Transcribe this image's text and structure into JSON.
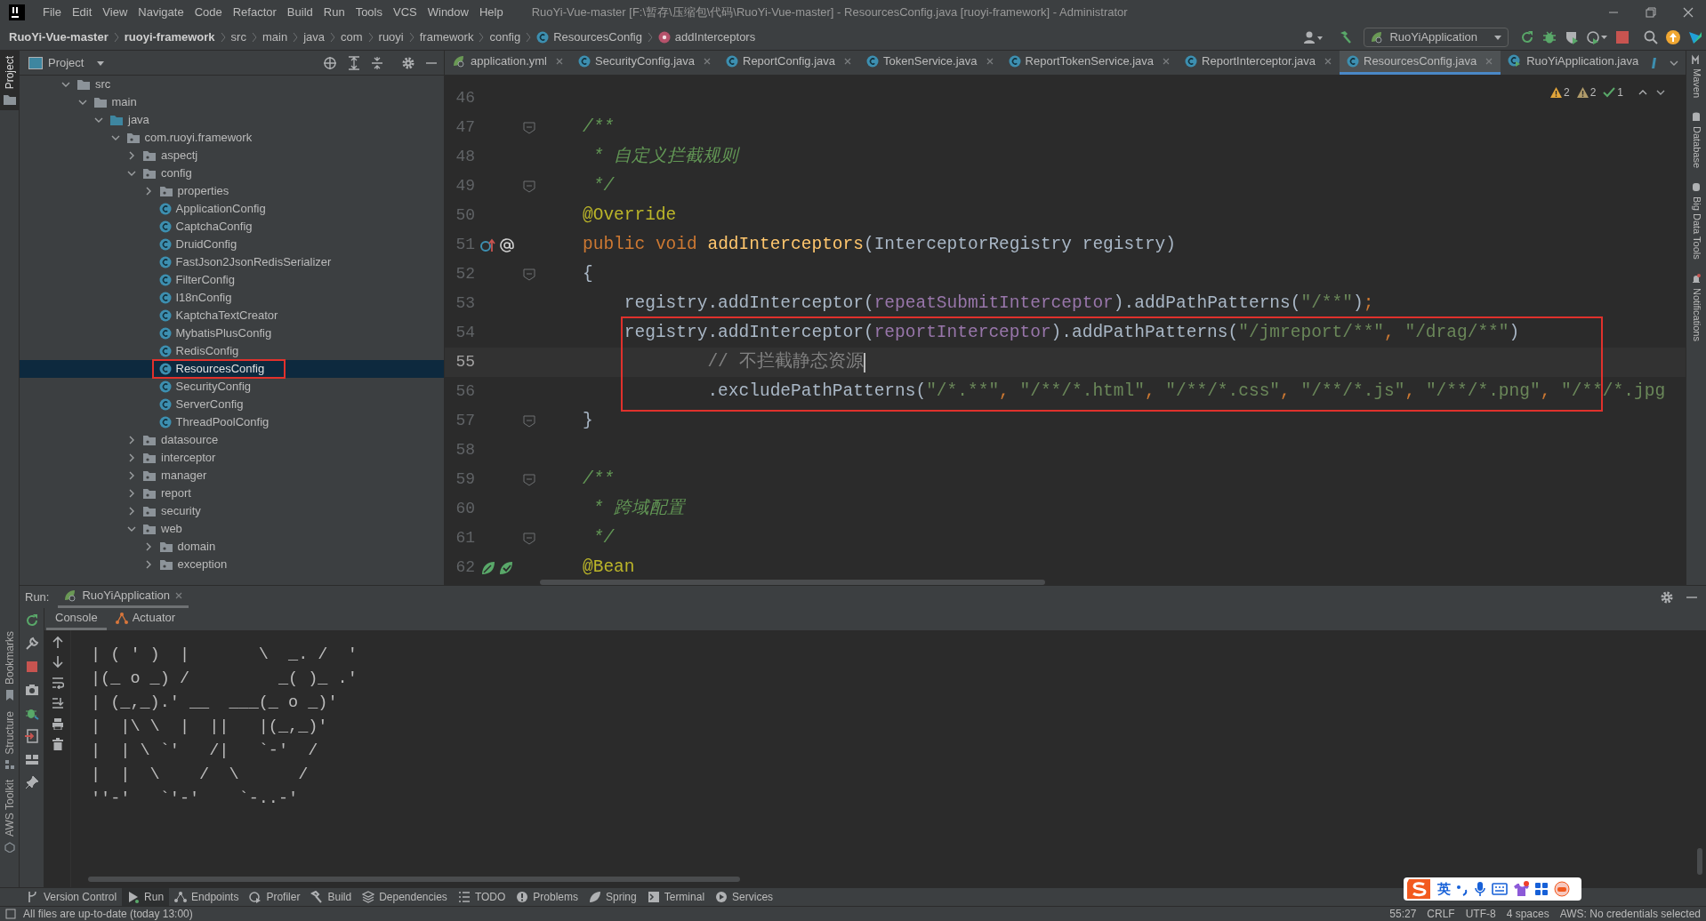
{
  "title_bar": {
    "menu": [
      "File",
      "Edit",
      "View",
      "Navigate",
      "Code",
      "Refactor",
      "Build",
      "Run",
      "Tools",
      "VCS",
      "Window",
      "Help"
    ],
    "title": "RuoYi-Vue-master [F:\\暂存\\压缩包\\代码\\RuoYi-Vue-master] - ResourcesConfig.java [ruoyi-framework] - Administrator"
  },
  "breadcrumbs": [
    {
      "label": "RuoYi-Vue-master",
      "kind": "module"
    },
    {
      "label": "ruoyi-framework",
      "kind": "module"
    },
    {
      "label": "src",
      "kind": "dir"
    },
    {
      "label": "main",
      "kind": "dir"
    },
    {
      "label": "java",
      "kind": "dir"
    },
    {
      "label": "com",
      "kind": "dir"
    },
    {
      "label": "ruoyi",
      "kind": "dir"
    },
    {
      "label": "framework",
      "kind": "dir"
    },
    {
      "label": "config",
      "kind": "dir"
    },
    {
      "label": "ResourcesConfig",
      "kind": "class"
    },
    {
      "label": "addInterceptors",
      "kind": "method"
    }
  ],
  "run_configuration": {
    "label": "RuoYiApplication"
  },
  "left_stripe": [
    {
      "label": "Project",
      "selected": true
    },
    {
      "label": "Bookmarks",
      "selected": false
    },
    {
      "label": "Structure",
      "selected": false
    },
    {
      "label": "AWS Toolkit",
      "selected": false
    }
  ],
  "project_panel": {
    "title": "Project",
    "tree": [
      {
        "label": "src",
        "kind": "folder",
        "expanded": true,
        "selected": false,
        "children": [
          {
            "label": "main",
            "kind": "folder",
            "expanded": true,
            "selected": false,
            "children": [
              {
                "label": "java",
                "kind": "source",
                "expanded": true,
                "selected": false,
                "children": [
                  {
                    "label": "com.ruoyi.framework",
                    "kind": "package",
                    "expanded": true,
                    "selected": false,
                    "children": [
                      {
                        "label": "aspectj",
                        "kind": "package",
                        "expanded": false,
                        "selected": false
                      },
                      {
                        "label": "config",
                        "kind": "package",
                        "expanded": true,
                        "selected": false,
                        "children": [
                          {
                            "label": "properties",
                            "kind": "package",
                            "expanded": false,
                            "selected": false
                          },
                          {
                            "label": "ApplicationConfig",
                            "kind": "class",
                            "selected": false
                          },
                          {
                            "label": "CaptchaConfig",
                            "kind": "class",
                            "selected": false
                          },
                          {
                            "label": "DruidConfig",
                            "kind": "class",
                            "selected": false
                          },
                          {
                            "label": "FastJson2JsonRedisSerializer",
                            "kind": "class",
                            "selected": false
                          },
                          {
                            "label": "FilterConfig",
                            "kind": "class",
                            "selected": false
                          },
                          {
                            "label": "I18nConfig",
                            "kind": "class",
                            "selected": false
                          },
                          {
                            "label": "KaptchaTextCreator",
                            "kind": "class",
                            "selected": false
                          },
                          {
                            "label": "MybatisPlusConfig",
                            "kind": "class",
                            "selected": false
                          },
                          {
                            "label": "RedisConfig",
                            "kind": "class",
                            "selected": false
                          },
                          {
                            "label": "ResourcesConfig",
                            "kind": "class",
                            "selected": true,
                            "boxed": true
                          },
                          {
                            "label": "SecurityConfig",
                            "kind": "class",
                            "selected": false
                          },
                          {
                            "label": "ServerConfig",
                            "kind": "class",
                            "selected": false
                          },
                          {
                            "label": "ThreadPoolConfig",
                            "kind": "class",
                            "selected": false
                          }
                        ]
                      },
                      {
                        "label": "datasource",
                        "kind": "package",
                        "expanded": false,
                        "selected": false
                      },
                      {
                        "label": "interceptor",
                        "kind": "package",
                        "expanded": false,
                        "selected": false
                      },
                      {
                        "label": "manager",
                        "kind": "package",
                        "expanded": false,
                        "selected": false
                      },
                      {
                        "label": "report",
                        "kind": "package",
                        "expanded": false,
                        "selected": false
                      },
                      {
                        "label": "security",
                        "kind": "package",
                        "expanded": false,
                        "selected": false
                      },
                      {
                        "label": "web",
                        "kind": "package",
                        "expanded": true,
                        "selected": false,
                        "children": [
                          {
                            "label": "domain",
                            "kind": "package",
                            "expanded": false,
                            "selected": false
                          },
                          {
                            "label": "exception",
                            "kind": "package",
                            "expanded": false,
                            "selected": false
                          }
                        ]
                      }
                    ]
                  }
                ]
              }
            ]
          }
        ]
      }
    ]
  },
  "editor": {
    "tabs": [
      {
        "label": "application.yml",
        "kind": "yaml",
        "selected": false,
        "closable": true
      },
      {
        "label": "SecurityConfig.java",
        "kind": "class",
        "selected": false,
        "closable": true
      },
      {
        "label": "ReportConfig.java",
        "kind": "class",
        "selected": false,
        "closable": true
      },
      {
        "label": "TokenService.java",
        "kind": "class",
        "selected": false,
        "closable": true
      },
      {
        "label": "ReportTokenService.java",
        "kind": "class",
        "selected": false,
        "closable": true
      },
      {
        "label": "ReportInterceptor.java",
        "kind": "class",
        "selected": false,
        "closable": true
      },
      {
        "label": "ResourcesConfig.java",
        "kind": "class",
        "selected": true,
        "closable": true
      },
      {
        "label": "RuoYiApplication.java",
        "kind": "main",
        "selected": false,
        "closable": false
      }
    ],
    "inspections": [
      {
        "kind": "warning",
        "count": "2"
      },
      {
        "kind": "weak",
        "count": "2"
      },
      {
        "kind": "ok",
        "count": "1"
      }
    ],
    "lines": [
      {
        "number": "46"
      },
      {
        "number": "47",
        "fold": true,
        "tokens": [
          {
            "text": "/**",
            "kind": "doc"
          }
        ]
      },
      {
        "number": "48",
        "tokens": [
          {
            "text": " * 自定义拦截规则",
            "kind": "doc"
          }
        ]
      },
      {
        "number": "49",
        "fold": true,
        "tokens": [
          {
            "text": " */",
            "kind": "doc"
          }
        ]
      },
      {
        "number": "50",
        "tokens": [
          {
            "text": "@Override",
            "kind": "annotation"
          }
        ]
      },
      {
        "number": "51",
        "kind": "override",
        "tokens": [
          {
            "text": "public void ",
            "kind": "keyword"
          },
          {
            "text": "addInterceptors",
            "kind": "method"
          },
          {
            "text": "(InterceptorRegistry registry)",
            "kind": "plain"
          }
        ]
      },
      {
        "number": "52",
        "fold": true,
        "tokens": [
          {
            "text": "{",
            "kind": "plain"
          }
        ]
      },
      {
        "number": "53",
        "tokens": [
          {
            "text": "    registry.addInterceptor(",
            "kind": "plain"
          },
          {
            "text": "repeatSubmitInterceptor",
            "kind": "field"
          },
          {
            "text": ").addPathPatterns(",
            "kind": "plain"
          },
          {
            "text": "\"/**\"",
            "kind": "string"
          },
          {
            "text": ")",
            "kind": "plain"
          },
          {
            "text": ";",
            "kind": "keyword"
          }
        ]
      },
      {
        "number": "54",
        "boxed": true,
        "tokens": [
          {
            "text": "    registry.addInterceptor(",
            "kind": "plain"
          },
          {
            "text": "reportInterceptor",
            "kind": "field"
          },
          {
            "text": ").addPathPatterns(",
            "kind": "plain"
          },
          {
            "text": "\"/jmreport/**\"",
            "kind": "string"
          },
          {
            "text": ", ",
            "kind": "keyword"
          },
          {
            "text": "\"/drag/**\"",
            "kind": "string"
          },
          {
            "text": ")",
            "kind": "plain"
          }
        ]
      },
      {
        "number": "55",
        "boxed": true,
        "current": true,
        "tokens": [
          {
            "text": "            // 不拦截静态资源",
            "kind": "comment"
          }
        ]
      },
      {
        "number": "56",
        "boxed": true,
        "tokens": [
          {
            "text": "            .excludePathPatterns(",
            "kind": "plain"
          },
          {
            "text": "\"/*.**\"",
            "kind": "string"
          },
          {
            "text": ", ",
            "kind": "keyword"
          },
          {
            "text": "\"/**/*.html\"",
            "kind": "string"
          },
          {
            "text": ", ",
            "kind": "keyword"
          },
          {
            "text": "\"/**/*.css\"",
            "kind": "string"
          },
          {
            "text": ", ",
            "kind": "keyword"
          },
          {
            "text": "\"/**/*.js\"",
            "kind": "string"
          },
          {
            "text": ", ",
            "kind": "keyword"
          },
          {
            "text": "\"/**/*.png\"",
            "kind": "string"
          },
          {
            "text": ", ",
            "kind": "keyword"
          },
          {
            "text": "\"/**/*.jpg",
            "kind": "string"
          }
        ]
      },
      {
        "number": "57",
        "fold": true,
        "tokens": [
          {
            "text": "}",
            "kind": "plain"
          }
        ]
      },
      {
        "number": "58"
      },
      {
        "number": "59",
        "fold": true,
        "tokens": [
          {
            "text": "/**",
            "kind": "doc"
          }
        ]
      },
      {
        "number": "60",
        "tokens": [
          {
            "text": " * 跨域配置",
            "kind": "doc"
          }
        ]
      },
      {
        "number": "61",
        "fold": true,
        "tokens": [
          {
            "text": " */",
            "kind": "doc"
          }
        ]
      },
      {
        "number": "62",
        "kind": "bean",
        "tokens": [
          {
            "text": "@Bean",
            "kind": "annotation"
          }
        ]
      }
    ]
  },
  "right_stripe": [
    "Maven",
    "Database",
    "Big Data Tools",
    "Notifications"
  ],
  "run_panel": {
    "label": "Run:",
    "tabs": [
      {
        "label": "RuoYiApplication",
        "selected": true
      }
    ],
    "console_tabs": [
      {
        "label": "Console",
        "selected": true
      },
      {
        "label": "Actuator",
        "selected": false
      }
    ],
    "output": [
      "| ( ' )  |       \\  _. /  '",
      "|(_ o _) /         _( )_ .'",
      "| (_,_).' __  ___(_ o _)'",
      "|  |\\ \\  |  ||   |(_,_)'",
      "|  | \\ `'   /|   `-'  /",
      "|  |  \\    /  \\      /",
      "''-'   `'-'    `-..-'"
    ]
  },
  "tool_windows": [
    {
      "label": "Version Control",
      "selected": false
    },
    {
      "label": "Run",
      "selected": true
    },
    {
      "label": "Endpoints",
      "selected": false
    },
    {
      "label": "Profiler",
      "selected": false
    },
    {
      "label": "Build",
      "selected": false
    },
    {
      "label": "Dependencies",
      "selected": false
    },
    {
      "label": "TODO",
      "selected": false
    },
    {
      "label": "Problems",
      "selected": false
    },
    {
      "label": "Spring",
      "selected": false
    },
    {
      "label": "Terminal",
      "selected": false
    },
    {
      "label": "Services",
      "selected": false
    }
  ],
  "status_bar": {
    "message": "All files are up-to-date (today 13:00)",
    "items": [
      "55:27",
      "CRLF",
      "UTF-8",
      "4 spaces",
      "AWS: No credentials selected"
    ]
  },
  "ime_toolbar": {
    "mode": "英"
  }
}
